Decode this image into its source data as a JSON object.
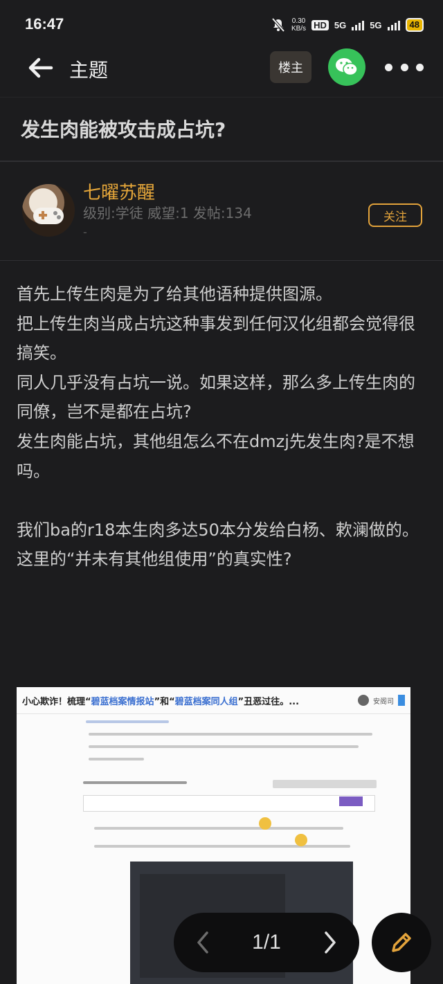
{
  "status_bar": {
    "time": "16:47",
    "net_speed_value": "0.30",
    "net_speed_unit": "KB/s",
    "hd_label": "HD",
    "sim1_label": "5G",
    "sim2_label": "5G",
    "battery": "48"
  },
  "nav": {
    "title": "主题",
    "louzhu_label": "楼主"
  },
  "post": {
    "title": "发生肉能被攻击成占坑?"
  },
  "author": {
    "name": "七曜苏醒",
    "info": "级别:学徒 威望:1 发帖:134",
    "extra": "-",
    "follow_label": "关注"
  },
  "content": {
    "paragraphs": [
      "首先上传生肉是为了给其他语种提供图源。",
      "把上传生肉当成占坑这种事发到任何汉化组都会觉得很搞笑。",
      "同人几乎没有占坑一说。如果这样，那么多上传生肉的同僚，岂不是都在占坑?",
      "发生肉能占坑，其他组怎么不在dmzj先发生肉?是不想吗。",
      "",
      "我们ba的r18本生肉多达50本分发给白杨、欶澜做的。",
      "这里的“并未有其他组使用”的真实性?"
    ]
  },
  "embedded_image": {
    "title_prefix": "小心欺诈！梳理“",
    "title_b1": "碧蓝档案情报站",
    "title_mid": "”和“",
    "title_b2": "碧蓝档案同人组",
    "title_suffix": "”丑恶过往。...",
    "user": "安阁司"
  },
  "pager": {
    "label": "1/1"
  },
  "colors": {
    "background": "#1c1c1e",
    "accent": "#e3a33b",
    "wechat": "#37c25a"
  }
}
